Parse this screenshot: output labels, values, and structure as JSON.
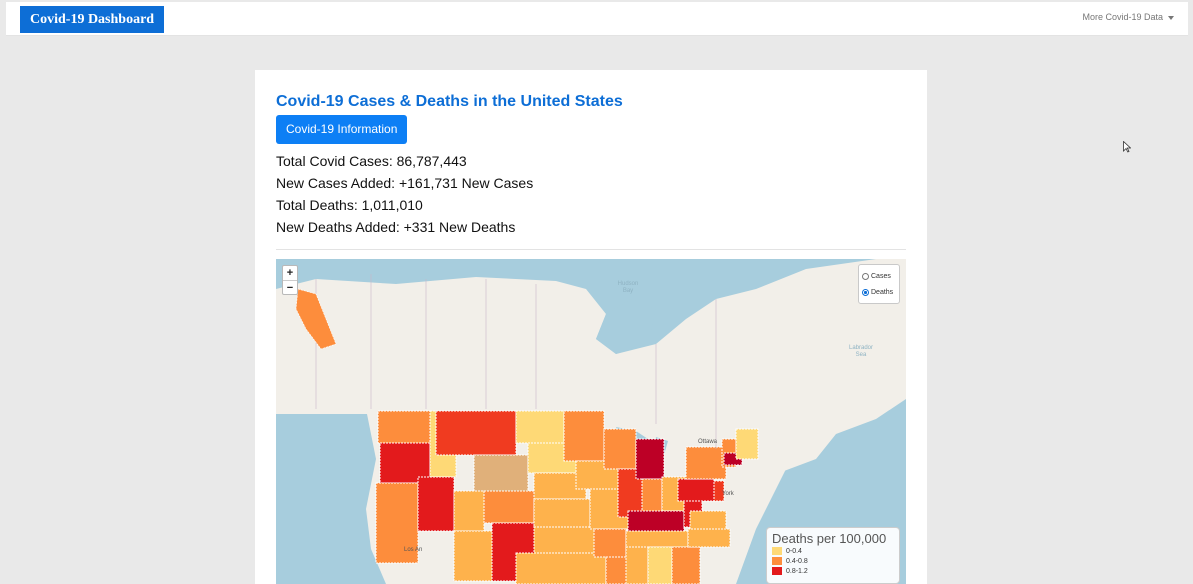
{
  "navbar": {
    "brand": "Covid-19 Dashboard",
    "menu_label": "More Covid-19 Data"
  },
  "panel": {
    "title": "Covid-19 Cases & Deaths in the United States",
    "info_button": "Covid-19 Information",
    "stats": [
      "Total Covid Cases: 86,787,443",
      "New Cases Added: +161,731 New Cases",
      "Total Deaths: 1,011,010",
      "New Deaths Added: +331 New Deaths"
    ]
  },
  "map": {
    "zoom_in": "+",
    "zoom_out": "−",
    "layers": [
      {
        "label": "Cases",
        "selected": false
      },
      {
        "label": "Deaths",
        "selected": true
      }
    ],
    "place_labels": {
      "hudson_bay": "Hudson Bay",
      "labrador_sea": "Labrador Sea",
      "ottawa": "Ottawa",
      "new_york": "York",
      "los_angeles": "Los An"
    },
    "legend": {
      "title": "Deaths per 100,000",
      "items": [
        {
          "label": "0-0.4",
          "color": "#fed976"
        },
        {
          "label": "0.4-0.8",
          "color": "#fd8d3c"
        },
        {
          "label": "0.8-1.2",
          "color": "#e31a1c"
        }
      ]
    }
  },
  "colors": {
    "brand_bg": "#0d6ed6",
    "button_bg": "#0d7ff5",
    "title": "#0d6ed6",
    "water": "#a7cddd",
    "land": "#f2efe9"
  }
}
